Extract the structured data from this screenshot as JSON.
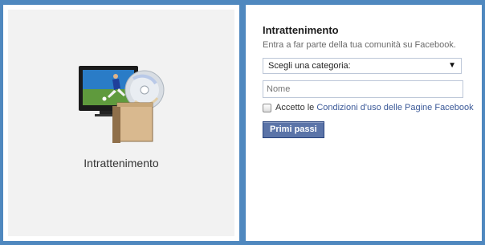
{
  "left_panel": {
    "caption": "Intrattenimento",
    "illustration_icon": "entertainment-icon"
  },
  "right_panel": {
    "title": "Intrattenimento",
    "description": "Entra a far parte della tua comunità su Facebook.",
    "category_select": {
      "value": "Scegli una categoria:"
    },
    "name_input": {
      "placeholder": "Nome",
      "value": ""
    },
    "terms": {
      "prefix": "Accetto le",
      "link_text": "Condizioni d'uso delle Pagine Facebook",
      "checked": false
    },
    "submit_label": "Primi passi"
  },
  "colors": {
    "background": "#4f88bf",
    "link": "#3b5998",
    "button": "#5b74a8"
  }
}
